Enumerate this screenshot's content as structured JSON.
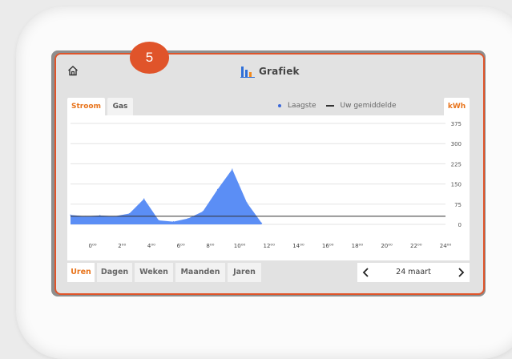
{
  "header": {
    "title": "Grafiek"
  },
  "badge": {
    "number": "5"
  },
  "tabs": {
    "stroom": "Stroom",
    "gas": "Gas",
    "unit": "kWh"
  },
  "legend": {
    "lowest": "Laagste",
    "average": "Uw gemiddelde"
  },
  "colors": {
    "accent": "#e8741c",
    "badge": "#e0542a",
    "series": "#5b8ef5",
    "frame": "#e0542a"
  },
  "icons": {
    "home": "home-icon",
    "chart": "bar-chart-icon",
    "prev": "chevron-left-icon",
    "next": "chevron-right-icon"
  },
  "chart_data": {
    "type": "area",
    "x_ticks": [
      "0⁰⁰",
      "2⁰⁰",
      "4⁰⁰",
      "6⁰⁰",
      "8⁰⁰",
      "10⁰⁰",
      "12⁰⁰",
      "14⁰⁰",
      "16⁰⁰",
      "18⁰⁰",
      "20⁰⁰",
      "22⁰⁰",
      "24⁰⁰"
    ],
    "y_ticks": [
      "375",
      "300",
      "225",
      "150",
      "75",
      "0"
    ],
    "ylim": [
      0,
      375
    ],
    "xlim": [
      -1.5,
      24
    ],
    "series": [
      {
        "name": "Laagste",
        "x": [
          -1.5,
          -0.5,
          0.5,
          1.5,
          2.5,
          3.5,
          4.5,
          5.5,
          6.5,
          7.5,
          8.5,
          9.5,
          10.5,
          11.5
        ],
        "y": [
          35,
          30,
          33,
          30,
          40,
          95,
          15,
          10,
          22,
          48,
          130,
          205,
          80,
          5
        ]
      }
    ],
    "average": 30,
    "grid": true
  },
  "bottom_tabs": [
    "Uren",
    "Dagen",
    "Weken",
    "Maanden",
    "Jaren"
  ],
  "active_bottom_tab": 0,
  "date": {
    "label": "24 maart"
  }
}
